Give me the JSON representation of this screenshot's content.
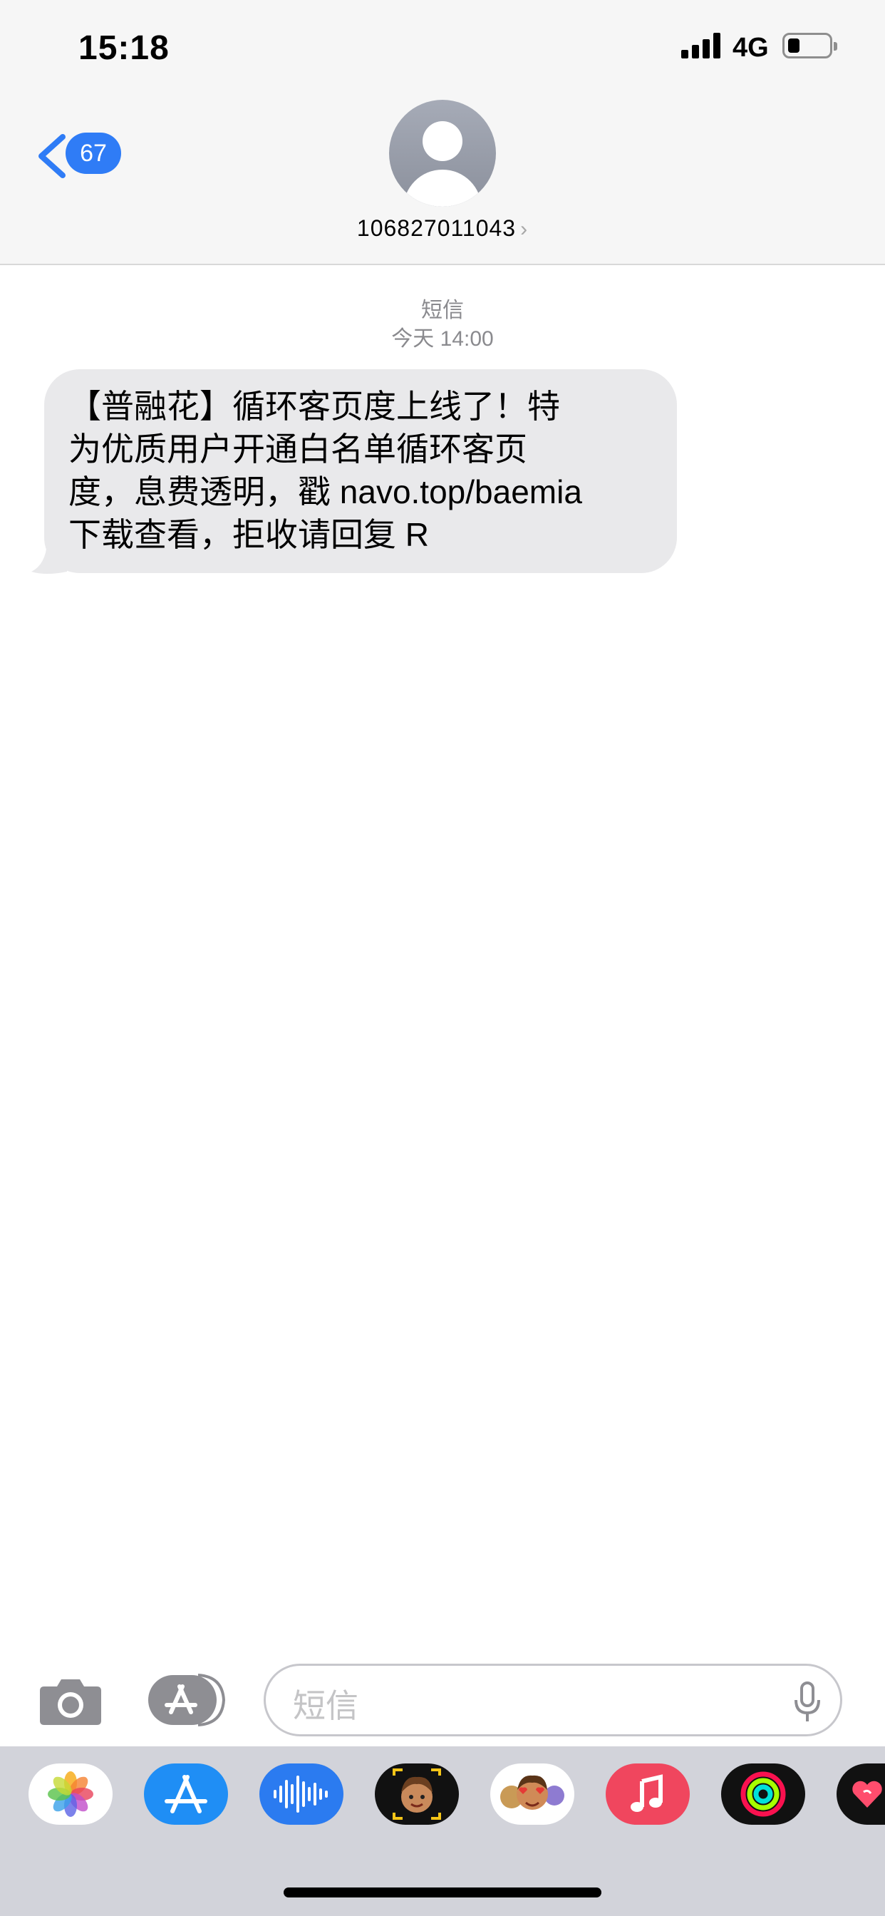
{
  "status_bar": {
    "time": "15:18",
    "network": "4G"
  },
  "header": {
    "back_badge": "67",
    "contact": "106827011043",
    "chevron": "›"
  },
  "conversation": {
    "service": "短信",
    "timestamp": "今天 14:00",
    "message_lines": [
      "【普融花】循环客页度上线了！特",
      "为优质用户开通白名单循环客页",
      "度，息费透明，戳 navo.top/baemia",
      "下载查看，拒收请回复 R"
    ]
  },
  "input_bar": {
    "placeholder": "短信"
  },
  "app_drawer": {
    "apps": [
      {
        "name": "photos",
        "color": "#ffffff"
      },
      {
        "name": "app-store",
        "color": "#1f8ef5"
      },
      {
        "name": "audio-message",
        "color": "#2b7bf0"
      },
      {
        "name": "memoji-camera",
        "color": "#111111"
      },
      {
        "name": "memoji-stickers",
        "color": "#ffffff"
      },
      {
        "name": "music",
        "color": "#f0465e"
      },
      {
        "name": "activity",
        "color": "#111111"
      },
      {
        "name": "digital-touch",
        "color": "#111111"
      }
    ]
  }
}
